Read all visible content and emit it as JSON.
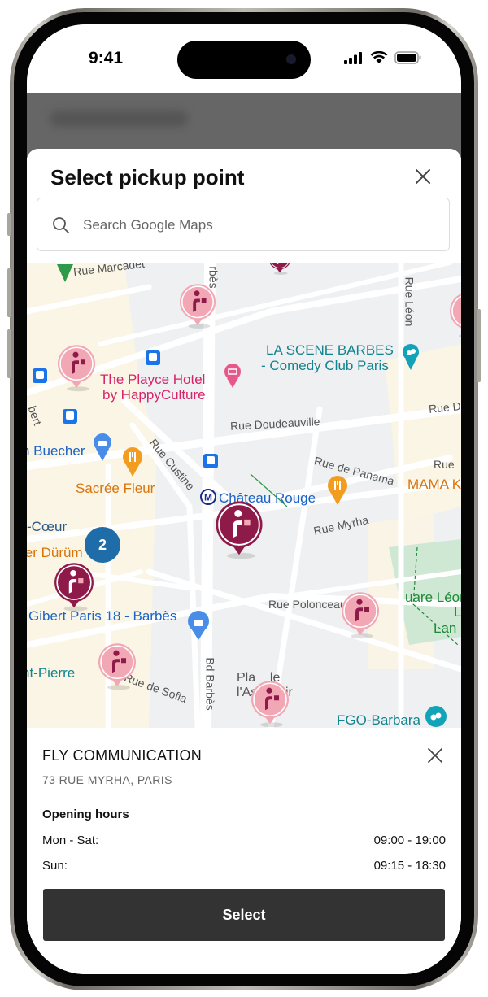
{
  "status_bar": {
    "time": "9:41"
  },
  "sheet": {
    "title": "Select pickup point",
    "search_placeholder": "Search Google Maps"
  },
  "map": {
    "streets": {
      "marcadet": "Rue Marcadet",
      "barbes_top": "rbès",
      "leon": "Rue Léon",
      "doudeauville": "Rue Doudeauville",
      "doudeauville_r": "Rue D",
      "custine": "Rue Custine",
      "panama": "Rue de Panama",
      "rue_r": "Rue",
      "myrha": "Rue Myrha",
      "polonceau": "Rue Polonceau",
      "sofia": "Rue de Sofia",
      "bd_barbes": "Bd Barbès",
      "robert": "bert"
    },
    "pois": {
      "playce_1": "The Playce Hotel",
      "playce_2": "by HappyCulture",
      "scene_1": "LA SCENE BARBES",
      "scene_2": "- Comedy Club Paris",
      "buecher": "n Buecher",
      "sacree": "Sacrée Fleur",
      "chateau": "Château Rouge",
      "mama": "MAMA K",
      "coeur": "-Cœur",
      "durum": "ier Dürüm",
      "gibert": "Gibert Paris 18 - Barbès",
      "square_leon": "uare Léon",
      "lan_1": "L",
      "lan_2": "Lan",
      "pierre": "nt-Pierre",
      "place_1": "Pla    le",
      "place_2": "l'Ass    oir",
      "fgo": "FGO-Barbara"
    },
    "cluster_count": "2"
  },
  "details": {
    "name": "FLY COMMUNICATION",
    "address": "73 RUE MYRHA, PARIS",
    "hours_title": "Opening hours",
    "hours": [
      {
        "days": "Mon - Sat:",
        "time": "09:00 - 19:00"
      },
      {
        "days": "Sun:",
        "time": "09:15 - 18:30"
      }
    ]
  },
  "select_label": "Select",
  "colors": {
    "marker_light": "#f2a7b5",
    "marker_dark": "#8e1a4a",
    "button": "#333333",
    "cluster": "#1f6da8"
  }
}
